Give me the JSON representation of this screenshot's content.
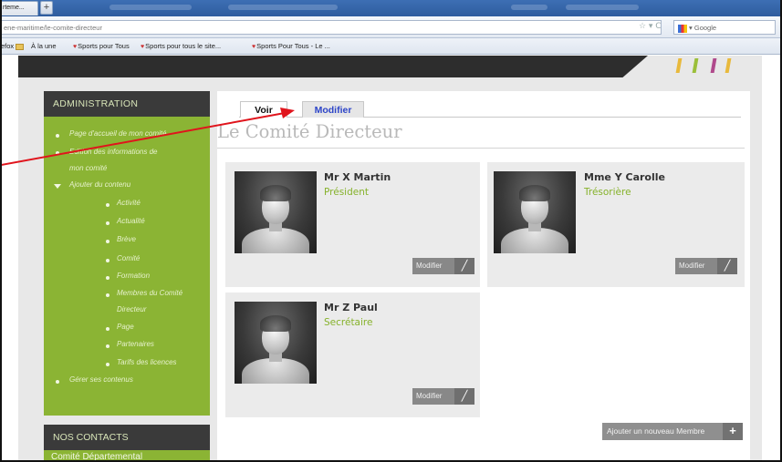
{
  "browser": {
    "tab_title": "rteme...",
    "new_tab_label": "+",
    "url": "ene-maritime/le-comite-directeur",
    "search_placeholder": "Google",
    "url_icons": "☆ ▾ C"
  },
  "bookmarks": [
    {
      "label": "efox"
    },
    {
      "label": "À la une"
    },
    {
      "label": "Sports pour Tous"
    },
    {
      "label": "Sports pour tous le site..."
    },
    {
      "label": "Sports Pour Tous - Le ..."
    }
  ],
  "sidebar": {
    "admin_title": "ADMINISTRATION",
    "items": [
      {
        "label": "Page d'accueil de mon comité"
      },
      {
        "label": "Edition des informations de"
      },
      {
        "label": "mon comité"
      },
      {
        "label": "Ajouter du contenu"
      },
      {
        "label": "Activité"
      },
      {
        "label": "Actualité"
      },
      {
        "label": "Brève"
      },
      {
        "label": "Comité"
      },
      {
        "label": "Formation"
      },
      {
        "label": "Membres du Comité"
      },
      {
        "label": "Directeur"
      },
      {
        "label": "Page"
      },
      {
        "label": "Partenaires"
      },
      {
        "label": "Tarifs des licences"
      },
      {
        "label": "Gérer ses contenus"
      }
    ],
    "contacts_title": "NOS CONTACTS",
    "contacts_text": "Comité Départemental"
  },
  "main": {
    "tabs": [
      {
        "label": "Voir"
      },
      {
        "label": "Modifier"
      }
    ],
    "page_title": "Le Comité Directeur",
    "members": [
      {
        "name": "Mr X Martin",
        "role": "Président",
        "edit_label": "Modifier"
      },
      {
        "name": "Mme Y Carolle",
        "role": "Trésorière",
        "edit_label": "Modifier"
      },
      {
        "name": "Mr Z Paul",
        "role": "Secrétaire",
        "edit_label": "Modifier"
      }
    ],
    "add_member_label": "Ajouter un nouveau Membre"
  },
  "colors": {
    "accent_green": "#8bb434",
    "role_green": "#86b22b",
    "dark_header": "#3a3a3a",
    "annotation_red": "#e0141c",
    "tab_blue": "#2d45c8"
  }
}
